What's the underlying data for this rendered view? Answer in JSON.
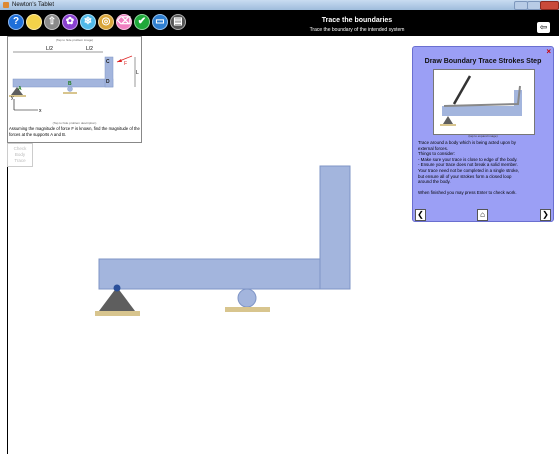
{
  "window": {
    "title": "Newton's Tablet"
  },
  "header": {
    "title": "Trace the boundaries",
    "subtitle": "Trace the boundary of the intended system"
  },
  "toolbar": {
    "tools": [
      {
        "name": "help-icon",
        "color": "#1e6fd9",
        "glyph": "?"
      },
      {
        "name": "notepad-icon",
        "color": "#f3d24a",
        "glyph": ""
      },
      {
        "name": "upload-icon",
        "color": "#8a8a8a",
        "glyph": "⇧"
      },
      {
        "name": "settings-gear-icon",
        "color": "#8a3fd1",
        "glyph": "✿"
      },
      {
        "name": "snowflake-icon",
        "color": "#4fb9e8",
        "glyph": "❄"
      },
      {
        "name": "target-icon",
        "color": "#d9a53a",
        "glyph": "◎"
      },
      {
        "name": "eraser-icon",
        "color": "#f07fc0",
        "glyph": "⌫"
      },
      {
        "name": "check-icon",
        "color": "#1fa83a",
        "glyph": "✔"
      },
      {
        "name": "keyboard-icon",
        "color": "#2f7fd1",
        "glyph": "▭"
      },
      {
        "name": "clapperboard-icon",
        "color": "#555555",
        "glyph": "▤"
      }
    ],
    "back_glyph": "⇦"
  },
  "problem": {
    "tap_hide_image": "(Tap to hide problem image)",
    "tap_hide_desc": "(Tap to hide problem description)",
    "text": "Assuming the magnitude of force F is known, find the magnitude of the forces at the supports A and B.",
    "labels": {
      "a": "A",
      "b": "B",
      "c": "C",
      "d": "D",
      "f": "F",
      "l2_1": "L/2",
      "l2_2": "L/2",
      "l": "L",
      "x": "x",
      "y": "y"
    }
  },
  "check_button": {
    "line1": "Check",
    "line2": "Body",
    "line3": "Trace"
  },
  "panel": {
    "title": "Draw Boundary Trace Strokes Step",
    "close_glyph": "×",
    "image_caption": "(tap to expand image)",
    "lines": [
      "Trace around a body which is being acted upon by",
      "external forces.",
      "Things to consider:",
      "  - Make sure your trace is close to edge of the body.",
      "  - Ensure your trace does not break a solid member.",
      "Your trace need not be completed in a single stroke,",
      "but ensure all of your strokes form a closed loop",
      "around the body.",
      "",
      "When finished you may press Enter to check work."
    ],
    "nav": {
      "prev": "❮",
      "home": "⌂",
      "next": "❯"
    }
  },
  "colors": {
    "body": "#a3b5dd",
    "body_edge": "#7f95c6",
    "support": "#5e5e5e",
    "ground": "#d8c58e",
    "roller": "#a3b5dd",
    "pin": "#2a4f9a"
  }
}
